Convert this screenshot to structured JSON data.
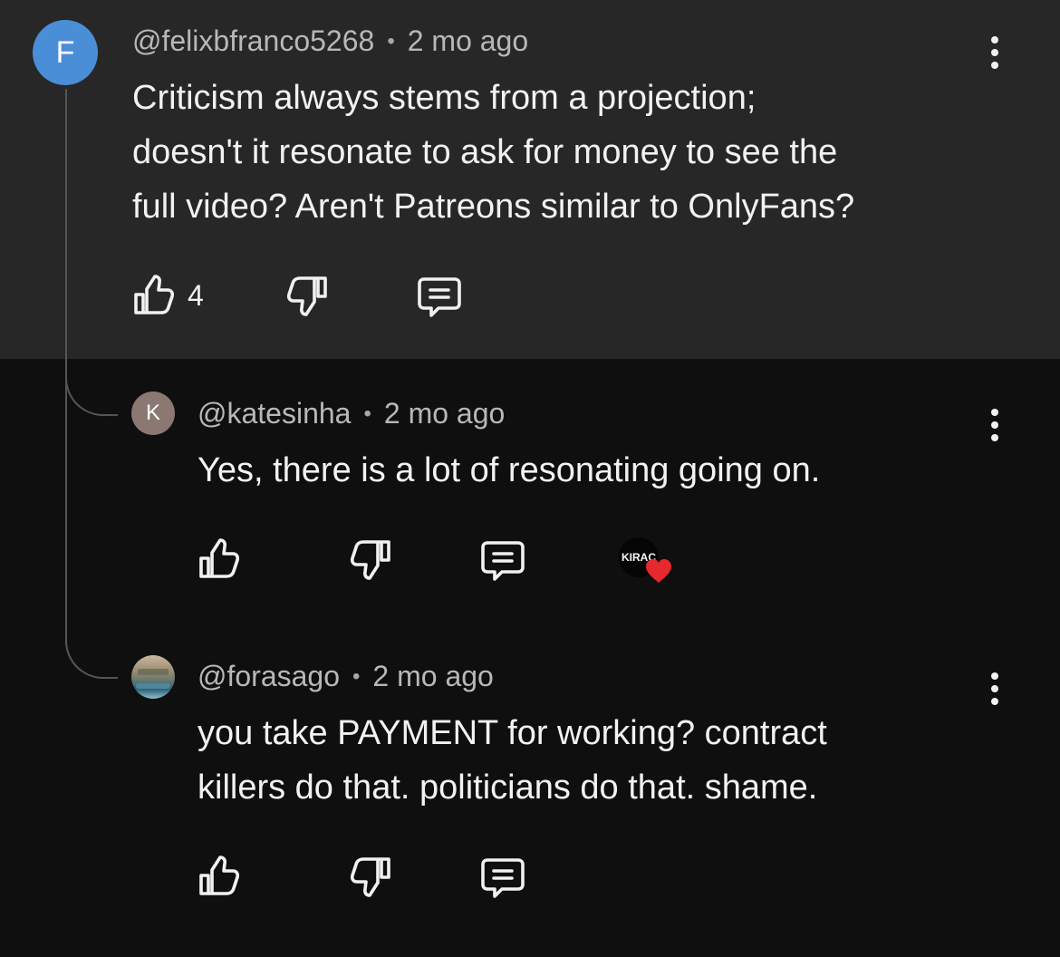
{
  "colors": {
    "background": "#0f0f0f",
    "highlighted_comment_background": "#272727",
    "primary_text": "#f1f1f1",
    "secondary_text": "#b8b8b8",
    "avatar_blue": "#4b8ed8",
    "avatar_brown": "#8c7873",
    "heart_red": "#e6282f",
    "thread_line": "#555555"
  },
  "comments": {
    "main": {
      "avatar_letter": "F",
      "username": "@felixbfranco5268",
      "separator": "•",
      "time": "2 mo ago",
      "text": "Criticism always stems from a projection;\ndoesn't it resonate to ask for money to see the\nfull video? Aren't Patreons similar to OnlyFans?",
      "like_count": "4",
      "icons": {
        "more": "vertical-more-icon",
        "like": "thumb-up-icon",
        "dislike": "thumb-down-icon",
        "reply": "reply-comment-icon"
      }
    },
    "replies": [
      {
        "avatar_letter": "K",
        "username": "@katesinha",
        "separator": "•",
        "time": "2 mo ago",
        "text": "Yes, there is a lot of resonating going on.",
        "creator_heart_avatar_text": "KIRAC",
        "icons": {
          "more": "vertical-more-icon",
          "like": "thumb-up-icon",
          "dislike": "thumb-down-icon",
          "reply": "reply-comment-icon",
          "creator_heart": "heart-icon"
        }
      },
      {
        "avatar_letter": "",
        "username": "@forasago",
        "separator": "•",
        "time": "2 mo ago",
        "text": "you take PAYMENT for working? contract\nkillers do that. politicians do that. shame.",
        "icons": {
          "more": "vertical-more-icon",
          "like": "thumb-up-icon",
          "dislike": "thumb-down-icon",
          "reply": "reply-comment-icon"
        }
      }
    ]
  }
}
